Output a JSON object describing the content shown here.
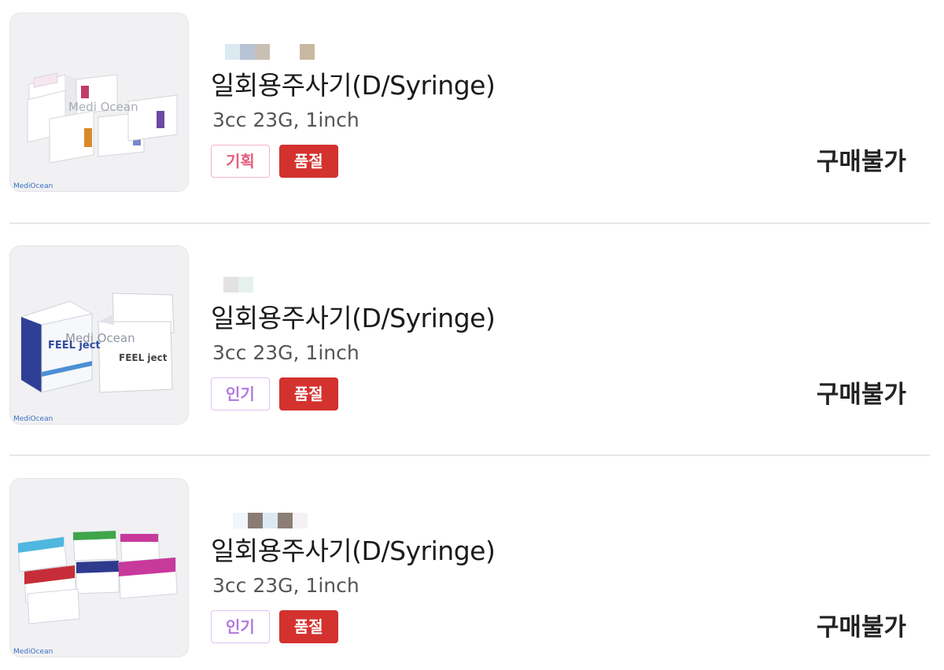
{
  "products": [
    {
      "title": "일회용주사기(D/Syringe)",
      "spec": "3cc 23G, 1inch",
      "badge": "기획",
      "badge_type": "plan",
      "soldout_label": "품절",
      "status": "구매불가",
      "watermark": "Medi Ocean"
    },
    {
      "title": "일회용주사기(D/Syringe)",
      "spec": "3cc 23G, 1inch",
      "badge": "인기",
      "badge_type": "popular",
      "soldout_label": "품절",
      "status": "구매불가",
      "watermark": "Medi Ocean"
    },
    {
      "title": "일회용주사기(D/Syringe)",
      "spec": "3cc 23G, 1inch",
      "badge": "인기",
      "badge_type": "popular",
      "soldout_label": "품절",
      "status": "구매불가",
      "watermark": "Medi Ocean"
    }
  ],
  "colors": {
    "plan_badge": "#e4607f",
    "popular_badge": "#b27ae0",
    "soldout_badge": "#d4322f",
    "status_text": "#222222"
  }
}
